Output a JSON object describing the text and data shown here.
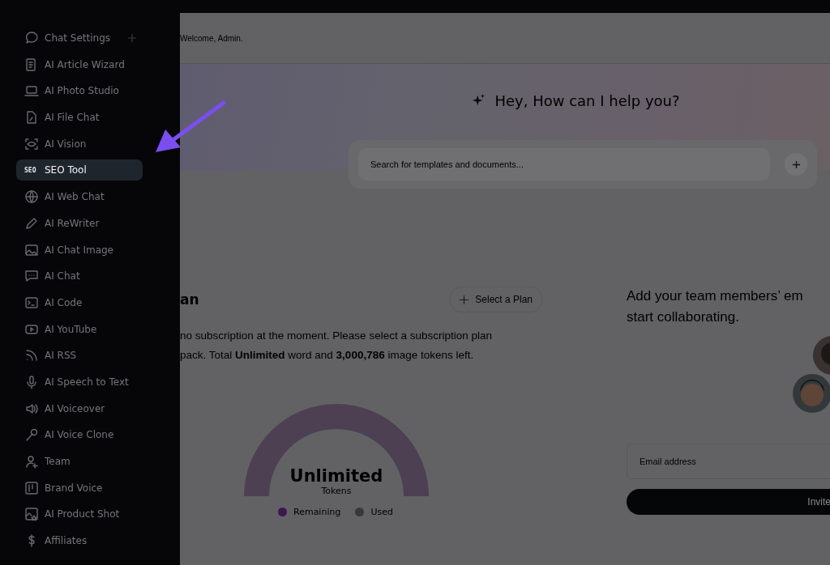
{
  "sidebar": {
    "items": [
      {
        "label": "Chat Settings",
        "selected": false,
        "has_add": true
      },
      {
        "label": "AI Article Wizard",
        "selected": false
      },
      {
        "label": "AI Photo Studio",
        "selected": false
      },
      {
        "label": "AI File Chat",
        "selected": false
      },
      {
        "label": "AI Vision",
        "selected": false
      },
      {
        "label": "SEO Tool",
        "selected": true,
        "icon_text": "SEO"
      },
      {
        "label": "AI Web Chat",
        "selected": false
      },
      {
        "label": "AI ReWriter",
        "selected": false
      },
      {
        "label": "AI Chat Image",
        "selected": false
      },
      {
        "label": "AI Chat",
        "selected": false
      },
      {
        "label": "AI Code",
        "selected": false
      },
      {
        "label": "AI YouTube",
        "selected": false
      },
      {
        "label": "AI RSS",
        "selected": false
      },
      {
        "label": "AI Speech to Text",
        "selected": false
      },
      {
        "label": "AI Voiceover",
        "selected": false
      },
      {
        "label": "AI Voice Clone",
        "selected": false
      },
      {
        "label": "Team",
        "selected": false
      },
      {
        "label": "Brand Voice",
        "selected": false
      },
      {
        "label": "AI Product Shot",
        "selected": false
      },
      {
        "label": "Affiliates",
        "selected": false
      }
    ]
  },
  "header": {
    "greeting": "Welcome, Admin."
  },
  "hero": {
    "title": "Hey, How can I help you?",
    "search": {
      "placeholder": "Search for templates and documents..."
    }
  },
  "plan": {
    "heading": "an",
    "button": "Select a Plan",
    "lines": [
      "no subscription at the moment. Please select a subscription plan",
      "pack. Total **Unlimited** word and **3,000,786** image tokens left."
    ],
    "gauge": {
      "value": "Unlimited",
      "unit": "Tokens"
    },
    "legend": [
      {
        "label": "Remaining",
        "color": "#3a1850"
      },
      {
        "label": "Used",
        "color": "#3a3640"
      }
    ]
  },
  "team": {
    "heading_lines": [
      "Add your team members’ em",
      "start collaborating."
    ],
    "email": {
      "placeholder": "Email address"
    },
    "button": "Invite"
  }
}
